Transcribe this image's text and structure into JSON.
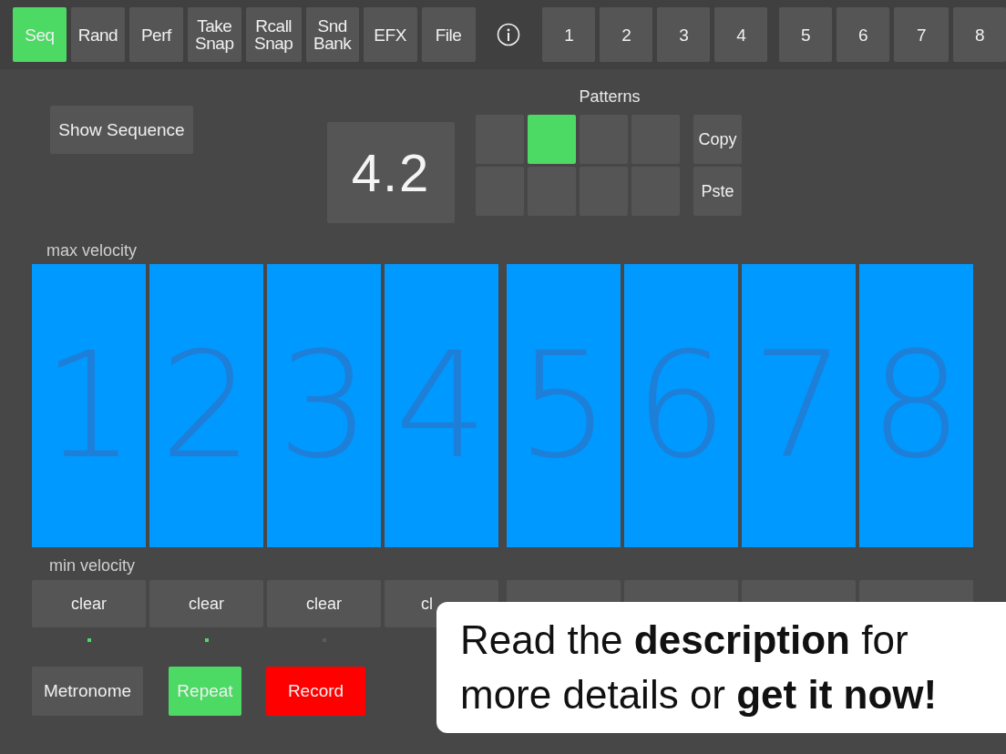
{
  "top_tabs": [
    {
      "label": "Seq",
      "selected": true
    },
    {
      "label": "Rand",
      "selected": false
    },
    {
      "label": "Perf",
      "selected": false
    },
    {
      "label": "Take\nSnap",
      "selected": false
    },
    {
      "label": "Rcall\nSnap",
      "selected": false
    },
    {
      "label": "Snd\nBank",
      "selected": false
    },
    {
      "label": "EFX",
      "selected": false
    },
    {
      "label": "File",
      "selected": false
    }
  ],
  "track_buttons": [
    "1",
    "2",
    "3",
    "4",
    "5",
    "6",
    "7",
    "8"
  ],
  "show_sequence_button": "Show Sequence",
  "display_value": "4.2",
  "patterns": {
    "title": "Patterns",
    "cells": [
      {
        "selected": false
      },
      {
        "selected": true
      },
      {
        "selected": false
      },
      {
        "selected": false
      },
      {
        "selected": false
      },
      {
        "selected": false
      },
      {
        "selected": false
      },
      {
        "selected": false
      }
    ],
    "copy_button": "Copy",
    "paste_button": "Pste"
  },
  "max_velocity_label": "max velocity",
  "pads": [
    "1",
    "2",
    "3",
    "4",
    "5",
    "6",
    "7",
    "8"
  ],
  "min_velocity_label": "min velocity",
  "clear_buttons": [
    {
      "label": "clear",
      "cut": false,
      "lit": true
    },
    {
      "label": "clear",
      "cut": false,
      "lit": true
    },
    {
      "label": "clear",
      "cut": false,
      "lit": false
    },
    {
      "label": "cl",
      "cut": true
    }
  ],
  "bottom_buttons": [
    {
      "label": "Metronome",
      "kind": "plain"
    },
    {
      "label": "Repeat",
      "kind": "on"
    },
    {
      "label": "Record",
      "kind": "record"
    }
  ],
  "promo": "Read the **description** for more details or **get it now!**"
}
